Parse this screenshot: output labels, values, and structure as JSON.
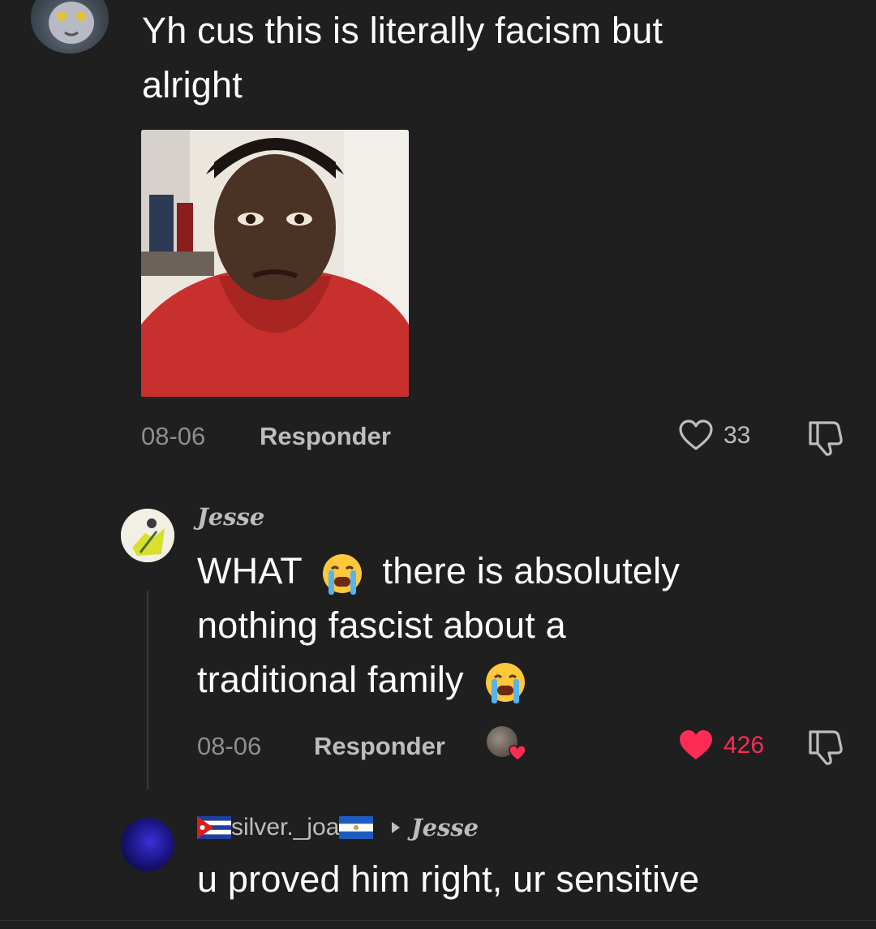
{
  "comment1": {
    "text_line1": "Yh cus this is literally facism but",
    "text_line2": "alright",
    "date": "08-06",
    "reply_label": "Responder",
    "like_count": "33"
  },
  "comment2": {
    "username": "Jesse",
    "text_line1_a": "WHAT",
    "text_line1_b": "there is absolutely",
    "text_line2": "nothing fascist about a",
    "text_line3": "traditional family",
    "date": "08-06",
    "reply_label": "Responder",
    "like_count": "426",
    "liked": true,
    "like_color": "#fe2c55"
  },
  "comment3": {
    "username": "silver._joa",
    "reply_to": "Jesse",
    "text": "u proved him right, ur sensitive"
  },
  "icons": [
    "heart-icon",
    "dislike-icon",
    "crying-emoji",
    "reply-arrow-icon",
    "cuba-flag-icon",
    "el-salvador-flag-icon"
  ]
}
